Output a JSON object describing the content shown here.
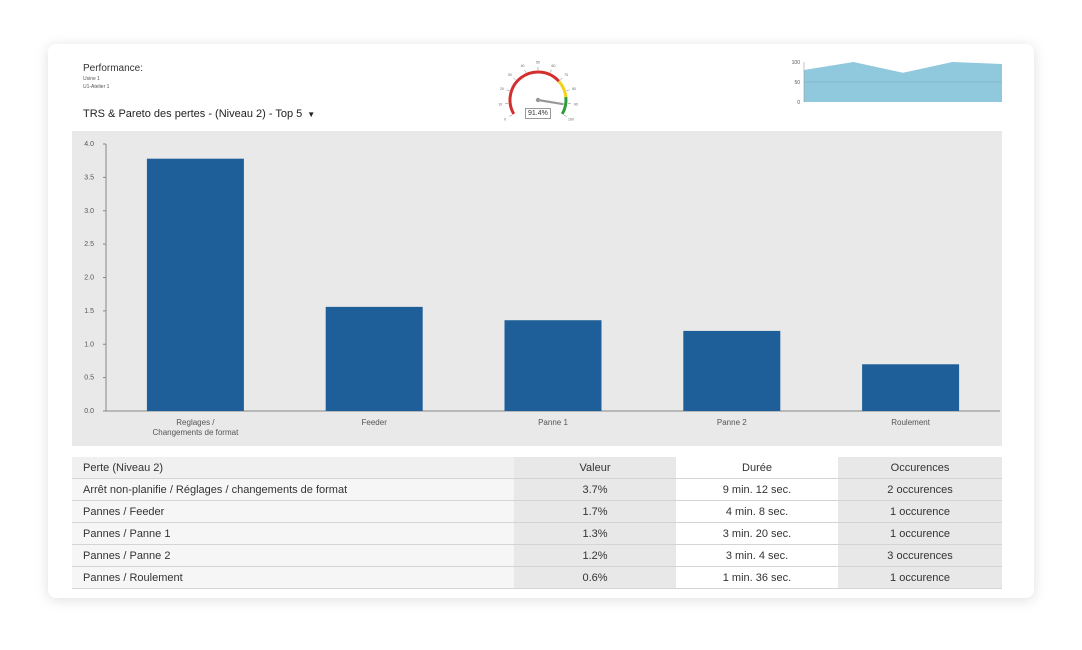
{
  "header": {
    "title": "Performance:",
    "site": "Usine 1",
    "workshop": "U1-Atelier 1",
    "selector_label": "TRS & Pareto des pertes - (Niveau 2) - Top 5",
    "selector_icon": "caret-down-icon"
  },
  "gauge": {
    "value": 91.4,
    "value_label": "91.4%",
    "min": 0,
    "max": 100,
    "ticks": [
      "0",
      "10",
      "20",
      "30",
      "40",
      "50",
      "60",
      "70",
      "80",
      "90",
      "100"
    ],
    "bands": [
      {
        "from": 0,
        "to": 70,
        "color": "#d32f2f"
      },
      {
        "from": 70,
        "to": 85,
        "color": "#f2d21a"
      },
      {
        "from": 85,
        "to": 100,
        "color": "#2e9e3c"
      }
    ]
  },
  "sparkline": {
    "y_ticks": [
      "100",
      "50",
      "0"
    ],
    "ymax": 100,
    "values": [
      80,
      100,
      73,
      100,
      95
    ],
    "reference": 50,
    "color": "#90c8dd"
  },
  "chart_data": {
    "type": "bar",
    "categories": [
      [
        "Reglages /",
        "Changements de format"
      ],
      [
        "Feeder"
      ],
      [
        "Panne 1"
      ],
      [
        "Panne 2"
      ],
      [
        "Roulement"
      ]
    ],
    "values": [
      3.78,
      1.56,
      1.36,
      1.2,
      0.7
    ],
    "ylim": [
      0,
      4.0
    ],
    "y_ticks": [
      "0.0",
      "0.5",
      "1.0",
      "1.5",
      "2.0",
      "2.5",
      "3.0",
      "3.5",
      "4.0"
    ],
    "bar_color": "#1f5f99",
    "background": "#e9e9e9",
    "grid": false,
    "title": "",
    "xlabel": "",
    "ylabel": ""
  },
  "table": {
    "headers": [
      "Perte (Niveau 2)",
      "Valeur",
      "Durée",
      "Occurences"
    ],
    "rows": [
      [
        "Arrêt non-planifie / Réglages / changements de format",
        "3.7%",
        "9 min. 12 sec.",
        "2 occurences"
      ],
      [
        "Pannes / Feeder",
        "1.7%",
        "4 min. 8 sec.",
        "1 occurence"
      ],
      [
        "Pannes / Panne 1",
        "1.3%",
        "3 min. 20 sec.",
        "1 occurence"
      ],
      [
        "Pannes / Panne 2",
        "1.2%",
        "3 min. 4 sec.",
        "3 occurences"
      ],
      [
        "Pannes / Roulement",
        "0.6%",
        "1 min. 36 sec.",
        "1 occurence"
      ]
    ]
  }
}
